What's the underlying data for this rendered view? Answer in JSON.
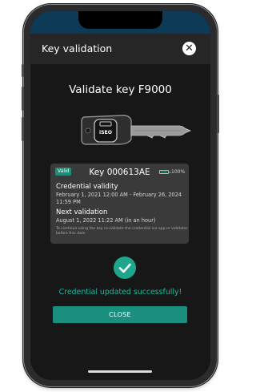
{
  "header": {
    "title": "Key validation",
    "close_icon": "close-icon"
  },
  "main": {
    "title": "Validate key F9000",
    "key_logo": "iSEO"
  },
  "card": {
    "badge": "Valid",
    "key_label": "Key 000613AE",
    "battery_pct": "100%",
    "validity_title": "Credential validity",
    "validity_range": "February 1, 2021 12:00 AM - February 26, 2024 11:59 PM",
    "next_title": "Next validation",
    "next_value": "August 1, 2022 11:22 AM (in an hour)",
    "note": "To continue using the key re-validate the credential via app or validator before this date"
  },
  "status": {
    "message": "Credential updated successfully!"
  },
  "actions": {
    "close_label": "CLOSE"
  },
  "colors": {
    "accent": "#1fa58c",
    "success_text": "#20b79c",
    "header_bg": "#262626",
    "status_bar_bg": "#0c3a57",
    "card_bg": "#3a3a3a"
  }
}
